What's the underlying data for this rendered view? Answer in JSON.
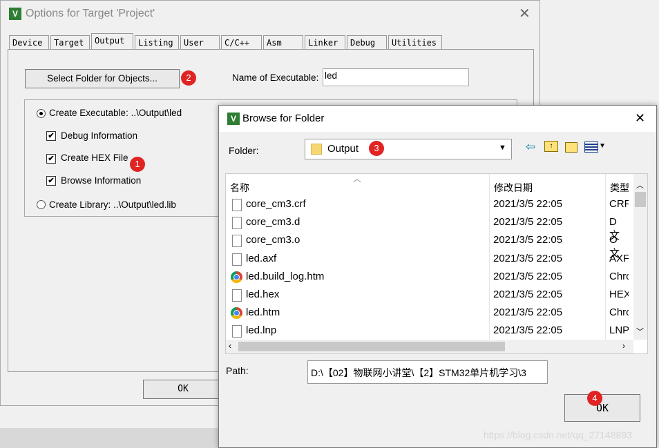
{
  "options_dialog": {
    "title": "Options for Target 'Project'",
    "tabs": [
      "Device",
      "Target",
      "Output",
      "Listing",
      "User",
      "C/C++",
      "Asm",
      "Linker",
      "Debug",
      "Utilities"
    ],
    "active_tab": "Output",
    "select_folder_label": "Select Folder for Objects...",
    "name_exec_label": "Name of Executable:",
    "name_exec_value": "led",
    "create_exec_label": "Create Executable:  ..\\Output\\led",
    "debug_info_label": "Debug Information",
    "create_hex_label": "Create HEX File",
    "browse_info_label": "Browse Information",
    "create_lib_label": "Create Library:  ..\\Output\\led.lib",
    "ok_label": "OK",
    "check_mark": "✔"
  },
  "browse_dialog": {
    "title": "Browse for Folder",
    "folder_label": "Folder:",
    "folder_value": "Output",
    "columns": {
      "name": "名称",
      "date": "修改日期",
      "type": "类型"
    },
    "files": [
      {
        "name": "core_cm3.crf",
        "date": "2021/3/5 22:05",
        "type": "CRF",
        "icon": "file"
      },
      {
        "name": "core_cm3.d",
        "date": "2021/3/5 22:05",
        "type": "D 文",
        "icon": "file"
      },
      {
        "name": "core_cm3.o",
        "date": "2021/3/5 22:05",
        "type": "O 文",
        "icon": "file"
      },
      {
        "name": "led.axf",
        "date": "2021/3/5 22:05",
        "type": "AXF",
        "icon": "file"
      },
      {
        "name": "led.build_log.htm",
        "date": "2021/3/5 22:05",
        "type": "Chro",
        "icon": "chrome"
      },
      {
        "name": "led.hex",
        "date": "2021/3/5 22:05",
        "type": "HEX",
        "icon": "file"
      },
      {
        "name": "led.htm",
        "date": "2021/3/5 22:05",
        "type": "Chro",
        "icon": "chrome"
      },
      {
        "name": "led.lnp",
        "date": "2021/3/5 22:05",
        "type": "LNP",
        "icon": "file"
      }
    ],
    "path_label": "Path:",
    "path_value": "D:\\【02】物联网小讲堂\\【2】STM32单片机学习\\3",
    "ok_label": "OK"
  },
  "badges": [
    "1",
    "2",
    "3",
    "4"
  ],
  "watermark": "https://blog.csdn.net/qq_27148893",
  "colors": {
    "badge": "#e02424",
    "accent": "#0078d7"
  }
}
